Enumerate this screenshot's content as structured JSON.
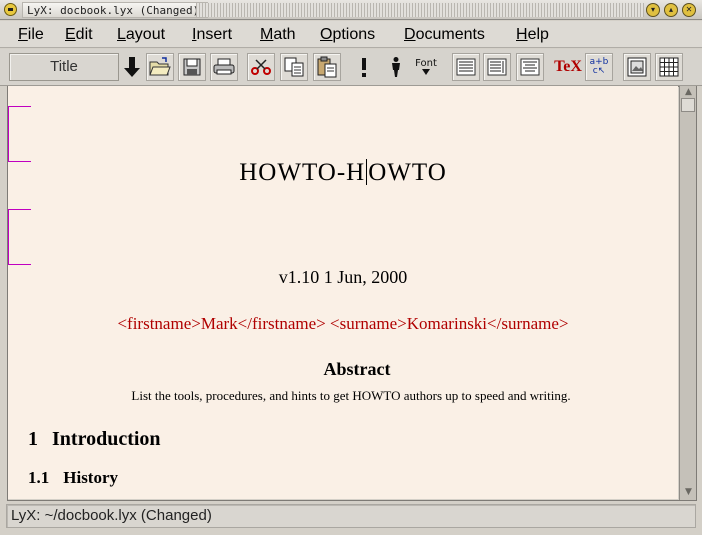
{
  "window": {
    "title": "LyX: docbook.lyx (Changed)"
  },
  "menu": {
    "items": [
      "File",
      "Edit",
      "Layout",
      "Insert",
      "Math",
      "Options",
      "Documents",
      "Help"
    ]
  },
  "toolbar": {
    "layout_value": "Title",
    "font_label": "Font",
    "tex_label": "TeX",
    "math_label": "a+b",
    "buttons": [
      "down-arrow-icon",
      "open-folder-icon",
      "save-icon",
      "print-icon",
      "cut-icon",
      "copy-icon",
      "paste-icon",
      "exclamation-icon",
      "person-icon",
      "font-icon",
      "align-left-icon",
      "align-right-icon",
      "align-center-icon",
      "tex-icon",
      "math-icon",
      "figure-icon",
      "table-icon"
    ]
  },
  "document": {
    "title_before_cursor": "HOWTO-H",
    "title_after_cursor": "OWTO",
    "date": "v1.10 1 Jun, 2000",
    "author": "<firstname>Mark</firstname> <surname>Komarinski</surname>",
    "abstract_heading": "Abstract",
    "abstract_text": "List the tools, procedures, and hints to get HOWTO authors up to speed and writing.",
    "section_number": "1",
    "section_title": "Introduction",
    "subsection_number": "1.1",
    "subsection_title": "History"
  },
  "statusbar": {
    "text": "LyX: ~/docbook.lyx (Changed)"
  },
  "colors": {
    "document_background": "#faf0e6",
    "author_text": "#b00000",
    "inset_bracket": "#c000c0",
    "tex_button": "#b00000"
  }
}
